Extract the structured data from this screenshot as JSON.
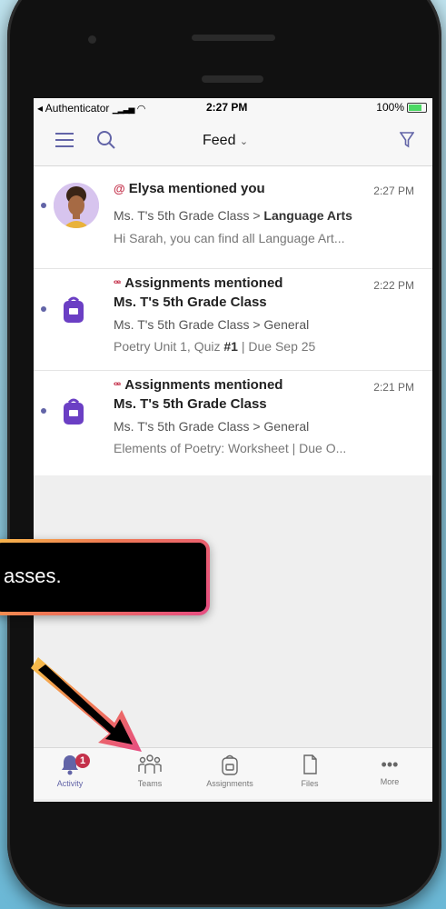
{
  "status_bar": {
    "back_app": "◂ Authenticator",
    "time": "2:27 PM",
    "battery": "100%"
  },
  "nav": {
    "title": "Feed",
    "menu_icon": "hamburger-icon",
    "search_icon": "search-icon",
    "filter_icon": "filter-icon"
  },
  "feed": [
    {
      "title": "Elysa mentioned you",
      "time": "2:27 PM",
      "line1_prefix": "Ms. T's 5th Grade Class > ",
      "line1_bold": "Language Arts",
      "line2": "Hi Sarah, you can find all Language Art..."
    },
    {
      "title": "Assignments mentioned",
      "time": "2:22 PM",
      "subtitle": "Ms. T's 5th Grade Class",
      "line1_prefix": "Ms. T's 5th Grade Class > General",
      "line2_prefix": "Poetry Unit 1, Quiz ",
      "line2_bold": "#1",
      "line2_suffix": " | Due Sep 25"
    },
    {
      "title": "Assignments mentioned",
      "time": "2:21 PM",
      "subtitle": "Ms. T's 5th Grade Class",
      "line1_prefix": "Ms. T's 5th Grade Class > General",
      "line2": "Elements of Poetry: Worksheet | Due O..."
    }
  ],
  "tabs": [
    {
      "label": "Activity",
      "badge": "1"
    },
    {
      "label": "Teams"
    },
    {
      "label": "Assignments"
    },
    {
      "label": "Files"
    },
    {
      "label": "More"
    }
  ],
  "callout": {
    "text": "asses."
  },
  "colors": {
    "accent": "#6264a7",
    "mention": "#c4314b"
  }
}
